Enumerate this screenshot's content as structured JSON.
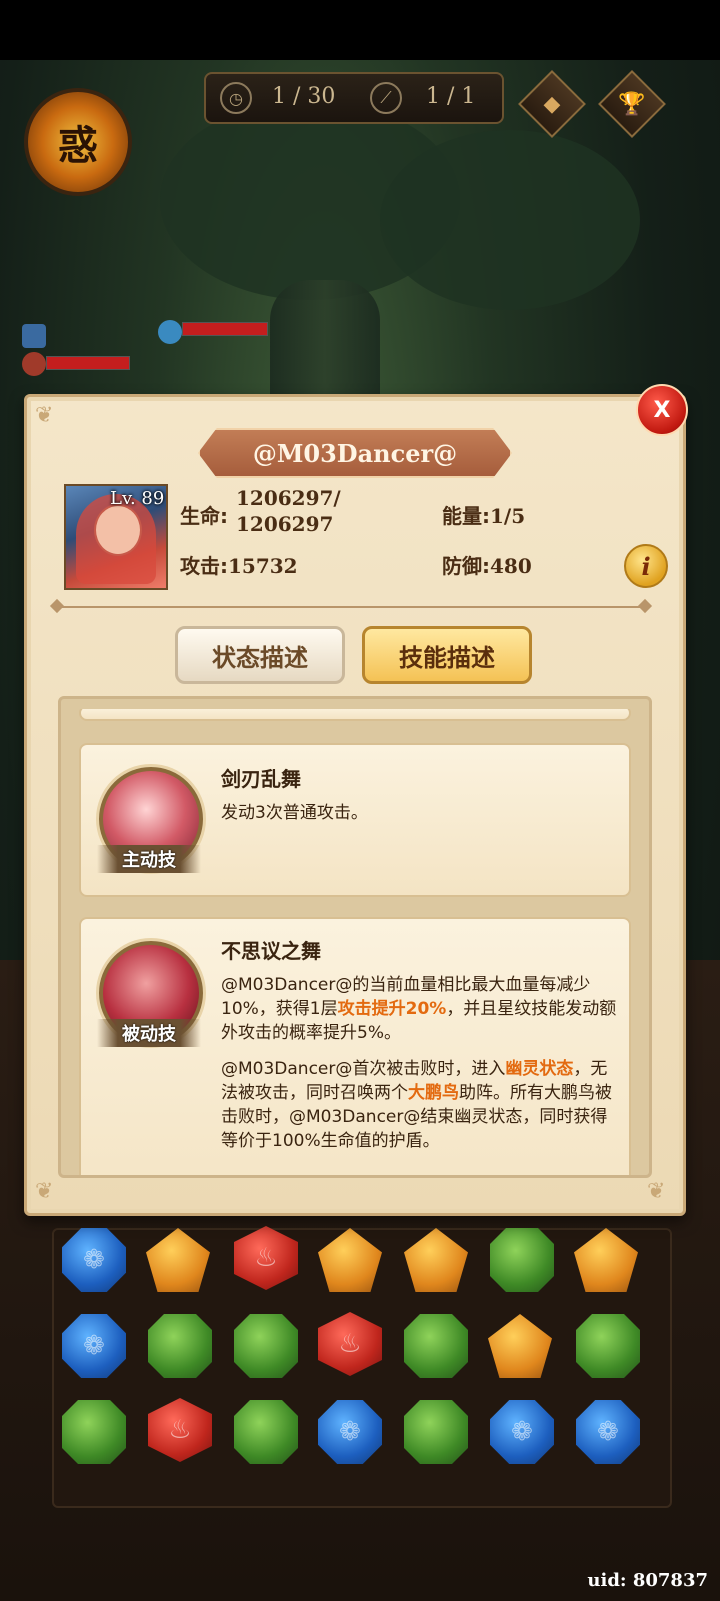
{
  "hud": {
    "turns_label": "1 / 30",
    "kills_label": "1 / 1",
    "turns_icon": "clock-icon",
    "kills_icon": "sword-icon",
    "boss_emblem_text": "惑",
    "right_buttons": [
      "diamond-emblem-icon",
      "trophy-icon"
    ]
  },
  "panel": {
    "title": "@M03Dancer@",
    "level": "Lv. 89",
    "stats": {
      "hp_label": "生命:",
      "hp_value_line1": "1206297/",
      "hp_value_line2": "1206297",
      "energy_label": "能量:",
      "energy_value": "1/5",
      "attack_label": "攻击:",
      "attack_value": "15732",
      "defense_label": "防御:",
      "defense_value": "480"
    },
    "info_button": "i",
    "tabs": {
      "status": "状态描述",
      "skill": "技能描述"
    },
    "skills": [
      {
        "name": "剑刃乱舞",
        "tag": "主动技",
        "desc": "发动3次普通攻击。"
      },
      {
        "name": "不思议之舞",
        "tag": "被动技",
        "p1_a": "@M03Dancer@的当前血量相比最大血量每减少10%，获得1层",
        "p1_hl": "攻击提升20%",
        "p1_b": "，并且星纹技能发动额外攻击的概率提升5%。",
        "p2_a": "@M03Dancer@首次被击败时，进入",
        "p2_hl1": "幽灵状态",
        "p2_b": "，无法被攻击，同时召唤两个",
        "p2_hl2": "大鹏鸟",
        "p2_c": "助阵。所有大鹏鸟被击败时，@M03Dancer@结束幽灵状态，同时获得等价于100%生命值的护盾。"
      }
    ]
  },
  "close_label": "X",
  "uid": "uid: 807837",
  "colors": {
    "highlight": "#e36a10",
    "panel_bg": "#f4e6c9",
    "close_red": "#c0180f"
  }
}
